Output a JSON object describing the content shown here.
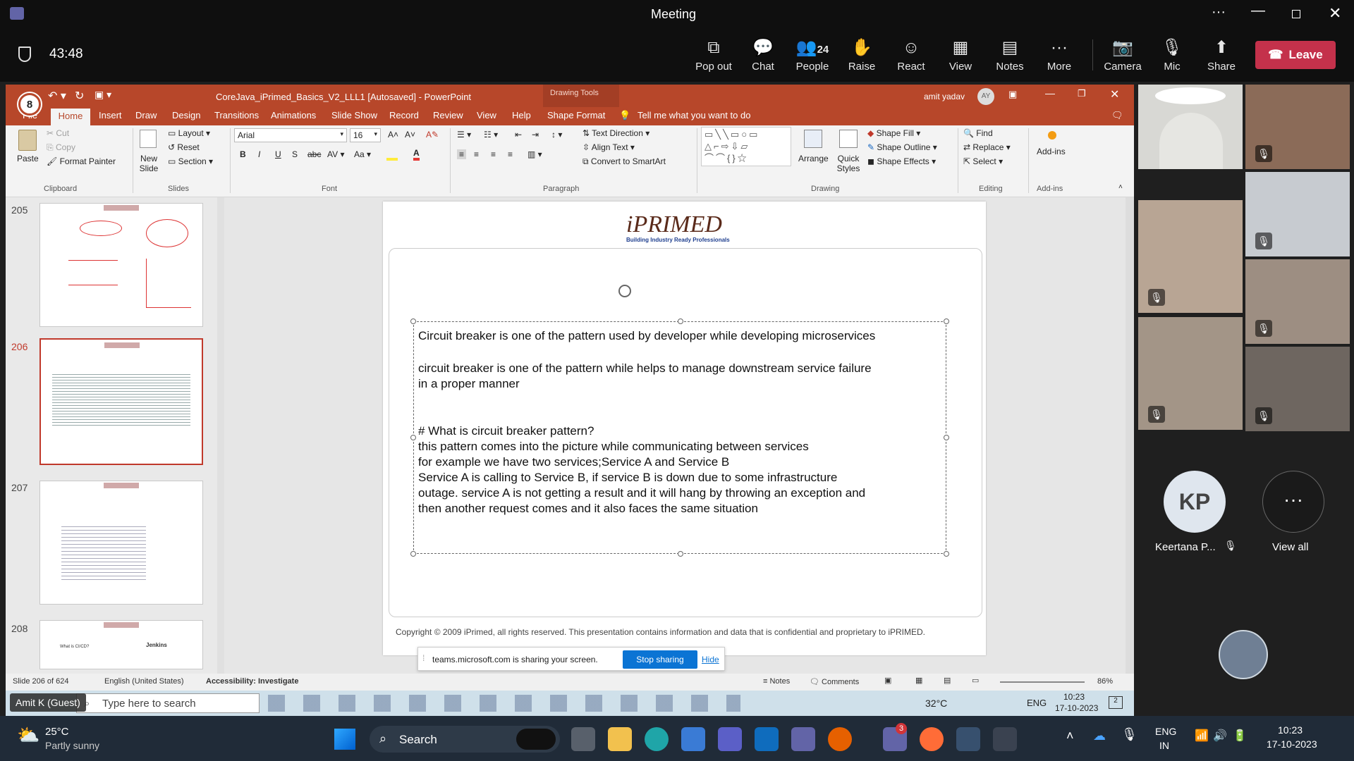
{
  "window": {
    "title": "Meeting"
  },
  "meeting": {
    "timer": "43:48",
    "buttons": [
      {
        "label": "Pop out",
        "icon": "pop-out-icon"
      },
      {
        "label": "Chat",
        "icon": "chat-icon"
      },
      {
        "label": "People",
        "icon": "people-icon",
        "count": "24"
      },
      {
        "label": "Raise",
        "icon": "raise-hand-icon"
      },
      {
        "label": "React",
        "icon": "react-icon"
      },
      {
        "label": "View",
        "icon": "view-icon"
      },
      {
        "label": "Notes",
        "icon": "notes-icon"
      },
      {
        "label": "More",
        "icon": "more-icon"
      },
      {
        "label": "Camera",
        "icon": "camera-off-icon"
      },
      {
        "label": "Mic",
        "icon": "mic-off-icon"
      },
      {
        "label": "Share",
        "icon": "share-icon"
      }
    ],
    "leave": "Leave"
  },
  "powerpoint": {
    "qat_badge": "8",
    "title": "CoreJava_iPrimed_Basics_V2_LLL1 [Autosaved]  -  PowerPoint",
    "drawing_tools": "Drawing Tools",
    "user": "amit yadav",
    "user_initials": "AY",
    "tabs": [
      "File",
      "Home",
      "Insert",
      "Draw",
      "Design",
      "Transitions",
      "Animations",
      "Slide Show",
      "Record",
      "Review",
      "View",
      "Help",
      "Shape Format"
    ],
    "tell_me": "Tell me what you want to do",
    "ribbon": {
      "paste": "Paste",
      "cut": "Cut",
      "copy": "Copy",
      "format_painter": "Format Painter",
      "new_slide": "New Slide",
      "layout": "Layout",
      "reset": "Reset",
      "section": "Section",
      "font_name": "Arial",
      "font_size": "16",
      "text_direction": "Text Direction",
      "align_text": "Align Text",
      "convert_smartart": "Convert to SmartArt",
      "arrange": "Arrange",
      "quick_styles": "Quick Styles",
      "shape_fill": "Shape Fill",
      "shape_outline": "Shape Outline",
      "shape_effects": "Shape Effects",
      "find": "Find",
      "replace": "Replace",
      "select": "Select",
      "addins": "Add-ins",
      "groups": [
        "Clipboard",
        "Slides",
        "Font",
        "Paragraph",
        "Drawing",
        "Editing",
        "Add-ins"
      ]
    },
    "thumbnails": [
      {
        "num": "205"
      },
      {
        "num": "206"
      },
      {
        "num": "207"
      },
      {
        "num": "208",
        "caption": "Jenkins",
        "line": "What is CI/CD?"
      }
    ],
    "slide": {
      "logo": "iPRIMED",
      "tagline": "Building Industry Ready Professionals",
      "lines": [
        "Circuit breaker is one of the pattern used by developer while developing microservices",
        "circuit breaker is one of the pattern while helps to manage downstream service failure",
        "in a proper manner",
        "# What is circuit breaker pattern?",
        "this pattern comes into the picture while communicating between services",
        "for example we have two services;Service A and Service B",
        "Service A is calling to Service B, if service B is down due to some infrastructure",
        "outage. service A is not getting a result and it will hang by throwing an exception and",
        "then another request comes and it also faces the same situation"
      ],
      "copyright": "Copyright © 2009 iPrimed, all rights reserved. This presentation contains information  and data  that is confidential and proprietary to iPRIMED."
    },
    "sharing": {
      "text": "teams.microsoft.com is sharing your screen.",
      "stop": "Stop sharing",
      "hide": "Hide"
    },
    "status": {
      "slide": "Slide 206 of 624",
      "lang": "English (United States)",
      "accessibility": "Accessibility: Investigate",
      "notes": "Notes",
      "comments": "Comments",
      "zoom": "86%"
    },
    "inner_taskbar": {
      "search": "Type here to search",
      "weather": "32°C",
      "lang": "ENG",
      "time": "10:23",
      "date": "17-10-2023",
      "notif": "2"
    }
  },
  "presenter_label": "Amit K (Guest)",
  "participants": {
    "kp_initials": "KP",
    "kp_name": "Keertana P...",
    "view_all": "View all"
  },
  "taskbar": {
    "weather_temp": "25°C",
    "weather_desc": "Partly sunny",
    "search": "Search",
    "teams_badge": "3",
    "lang1": "ENG",
    "lang2": "IN",
    "time": "10:23",
    "date": "17-10-2023"
  }
}
